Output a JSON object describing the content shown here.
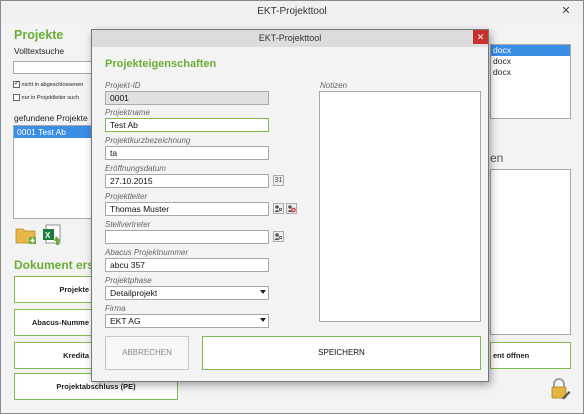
{
  "main": {
    "title": "EKT-Projekttool",
    "close": "✕",
    "projects_heading": "Projekte",
    "fulltext_label": "Volltextsuche",
    "search_value": "",
    "chk_not_closed": "nicht in abgeschlossenen",
    "chk_leader": "nur in Projektleiter such",
    "found_label": "gefundene Projekte",
    "found_items": [
      "0001 Test Ab"
    ],
    "doc_heading": "Dokument erste",
    "right_files": [
      "docx",
      "docx",
      "docx"
    ],
    "right_heading_fragment": "en",
    "btn_projekt": "Projekte",
    "btn_abacus": "Abacus-Numme",
    "btn_kredit": "Kredita",
    "btn_dokument_oeffnen": "ent öffnen",
    "btn_projektabschluss": "Projektabschluss (PE)"
  },
  "modal": {
    "title": "EKT-Projekttool",
    "close": "✕",
    "heading": "Projekteigenschaften",
    "notes_label": "Notizen",
    "notes_value": "",
    "fields": {
      "id_label": "Projekt-ID",
      "id_value": "0001",
      "name_label": "Projektname",
      "name_value": "Test Ab",
      "short_label": "Projektkurzbezeichnung",
      "short_value": "ta",
      "date_label": "Eröffnungsdatum",
      "date_value": "27.10.2015",
      "leader_label": "Projektleiter",
      "leader_value": "Thomas Muster",
      "deputy_label": "Stellvertreter",
      "deputy_value": "",
      "abacus_label": "Abacus Projektnummer",
      "abacus_value": "abcu 357",
      "phase_label": "Projektphase",
      "phase_value": "Detailprojekt",
      "company_label": "Firma",
      "company_value": "EKT AG"
    },
    "cancel_label": "ABBRECHEN",
    "save_label": "SPEICHERN",
    "calendar_icon_text": "31"
  },
  "colors": {
    "accent_green": "#6aae36",
    "close_red": "#c9302c",
    "list_selection": "#3a8ee6"
  },
  "icons": [
    "folder-add-icon",
    "excel-export-icon",
    "calendar-icon",
    "person-search-icon",
    "person-remove-icon",
    "lock-edit-icon"
  ]
}
